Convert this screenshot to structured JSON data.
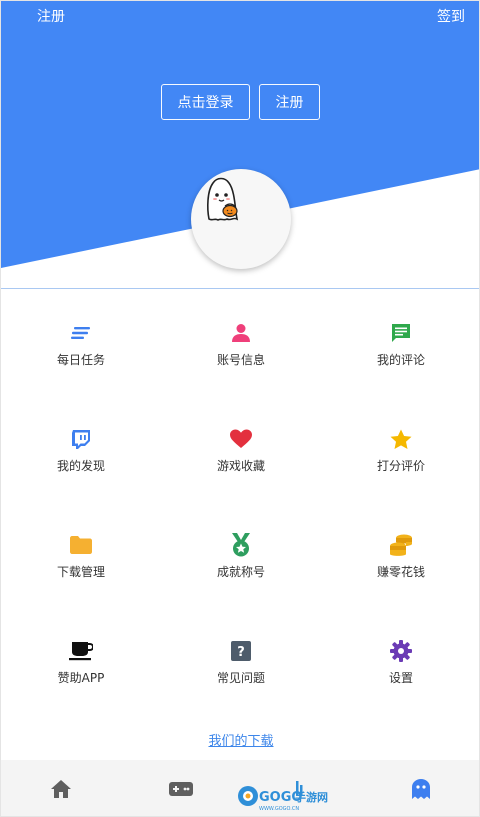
{
  "header": {
    "left_link": "注册",
    "right_link": "签到",
    "login_button": "点击登录",
    "register_button": "注册",
    "accent_color": "#4287f5"
  },
  "menu": {
    "items": [
      {
        "label": "每日任务",
        "icon": "list-icon",
        "color": "#3e7fef"
      },
      {
        "label": "账号信息",
        "icon": "person-icon",
        "color": "#ef3f7a"
      },
      {
        "label": "我的评论",
        "icon": "comment-icon",
        "color": "#2ea84b"
      },
      {
        "label": "我的发现",
        "icon": "twitch-icon",
        "color": "#3e7fef"
      },
      {
        "label": "游戏收藏",
        "icon": "heart-icon",
        "color": "#e3303e"
      },
      {
        "label": "打分评价",
        "icon": "star-icon",
        "color": "#f5b800"
      },
      {
        "label": "下载管理",
        "icon": "folder-icon",
        "color": "#f5b031"
      },
      {
        "label": "成就称号",
        "icon": "medal-icon",
        "color": "#2e9e5f"
      },
      {
        "label": "赚零花钱",
        "icon": "coins-icon",
        "color": "#f2b21a"
      },
      {
        "label": "赞助APP",
        "icon": "coffee-icon",
        "color": "#111111"
      },
      {
        "label": "常见问题",
        "icon": "question-icon",
        "color": "#4e5c6b"
      },
      {
        "label": "设置",
        "icon": "gear-icon",
        "color": "#6b3bb5"
      }
    ]
  },
  "footer": {
    "download_link": "我们的下载"
  },
  "tabbar": {
    "tabs": [
      {
        "icon": "home-icon"
      },
      {
        "icon": "gamepad-icon"
      },
      {
        "icon": "ghost-icon",
        "active": true
      }
    ]
  },
  "watermark": {
    "brand": "GOGO",
    "suffix": "手游网",
    "domain": "WWW.GOGO.CN"
  }
}
